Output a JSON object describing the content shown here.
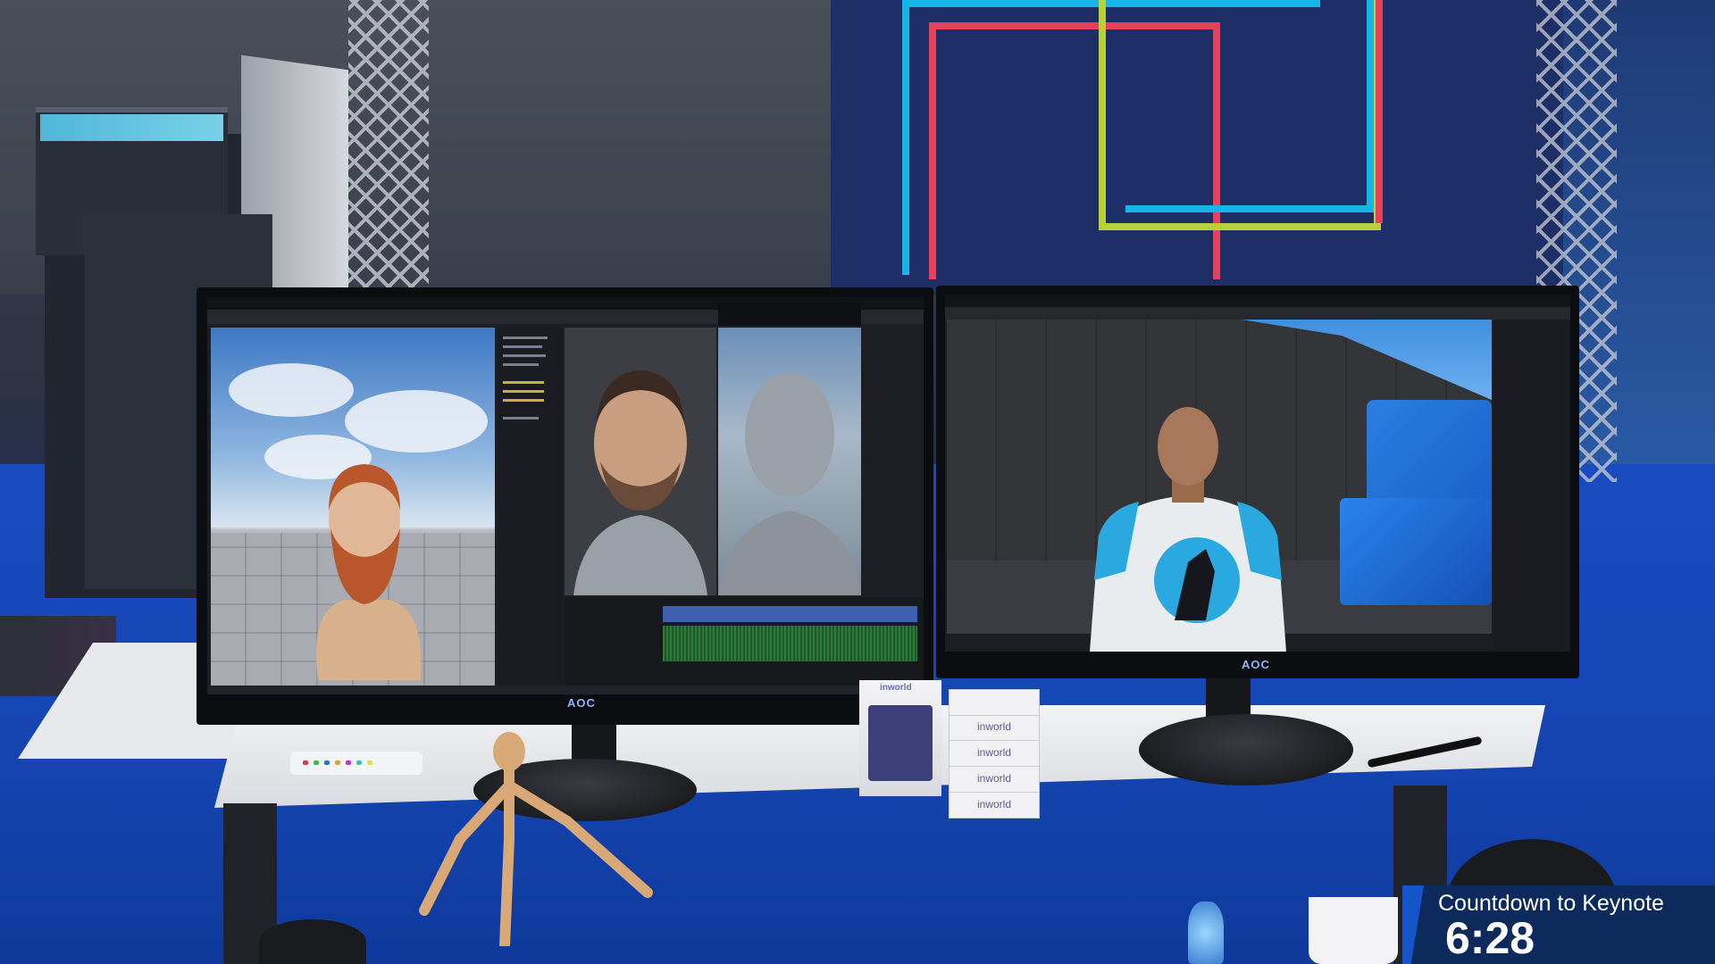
{
  "overlay": {
    "countdown_label": "Countdown to Keynote",
    "countdown_time": "6:28"
  },
  "monitors": {
    "left_brand": "AOC",
    "right_brand": "AOC"
  },
  "desk": {
    "cards": [
      "inworld",
      "inworld",
      "inworld",
      "inworld"
    ],
    "box_label": "inworld"
  },
  "colors": {
    "countdown_bg": "#0d2a5c",
    "carpet": "#1547b4",
    "sofa": "#2b7fe0",
    "shirt_accent": "#2aa8e0"
  }
}
